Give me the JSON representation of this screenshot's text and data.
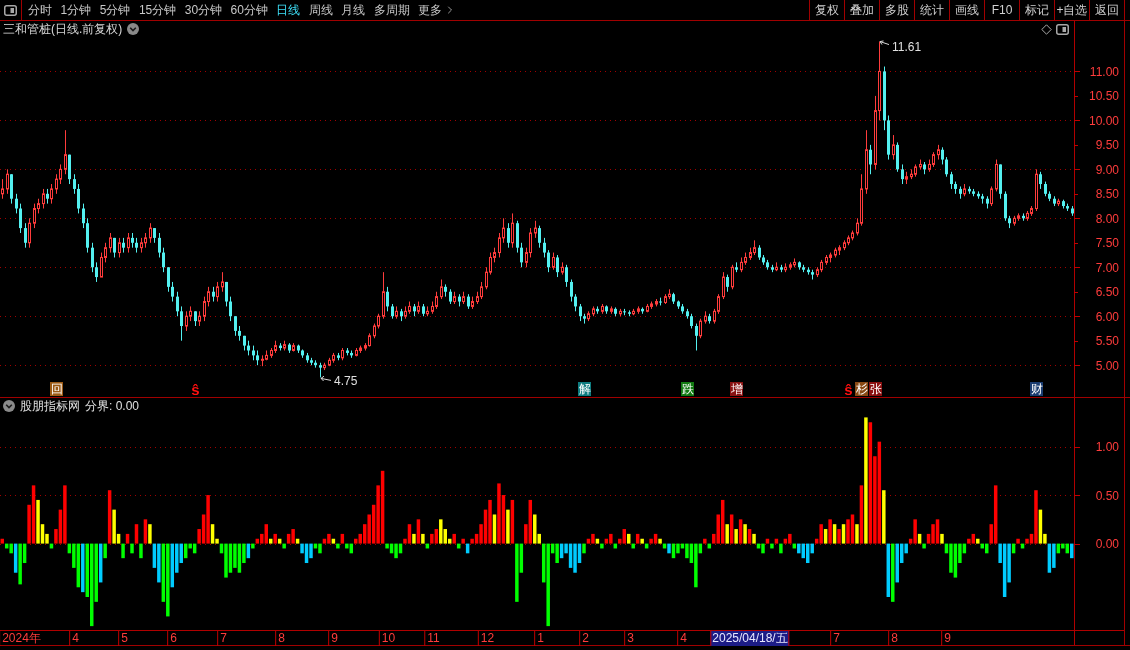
{
  "toolbar": {
    "tabs": [
      {
        "label": "分时",
        "selected": false
      },
      {
        "label": "1分钟",
        "selected": false
      },
      {
        "label": "5分钟",
        "selected": false
      },
      {
        "label": "15分钟",
        "selected": false
      },
      {
        "label": "30分钟",
        "selected": false
      },
      {
        "label": "60分钟",
        "selected": false
      },
      {
        "label": "日线",
        "selected": true
      },
      {
        "label": "周线",
        "selected": false
      },
      {
        "label": "月线",
        "selected": false
      },
      {
        "label": "多周期",
        "selected": false
      }
    ],
    "more_label": "更多",
    "buttons": [
      "复权",
      "叠加",
      "多股",
      "统计",
      "画线",
      "F10",
      "标记",
      "+自选",
      "返回"
    ]
  },
  "price": {
    "title": "三和管桩(日线.前复权)",
    "chart_data": {
      "type": "candlestick",
      "grid": true,
      "ylim": [
        4.35,
        12.03
      ],
      "yticks": [
        {
          "value": 5,
          "label": "5.00"
        },
        {
          "value": 5.5,
          "label": "5.50"
        },
        {
          "value": 6,
          "label": "6.00"
        },
        {
          "value": 6.5,
          "label": "6.50"
        },
        {
          "value": 7,
          "label": "7.00"
        },
        {
          "value": 7.5,
          "label": "7.50"
        },
        {
          "value": 8,
          "label": "8.00"
        },
        {
          "value": 8.5,
          "label": "8.50"
        },
        {
          "value": 9,
          "label": "9.00"
        },
        {
          "value": 9.5,
          "label": "9.50"
        },
        {
          "value": 10,
          "label": "10.00"
        },
        {
          "value": 10.5,
          "label": "10.50"
        },
        {
          "value": 11,
          "label": "11.00"
        }
      ],
      "annotations": [
        "11.61",
        "4.75"
      ],
      "categories": [
        null,
        null,
        null,
        null,
        null,
        null,
        null,
        null,
        null,
        null,
        null,
        null,
        "回",
        null,
        null,
        null,
        null,
        null,
        null,
        null,
        null,
        null,
        null,
        null,
        null,
        null,
        null,
        null,
        null,
        null,
        null,
        null,
        null,
        null,
        null,
        null,
        null,
        null,
        null,
        null,
        null,
        null,
        null,
        "ŝ",
        null,
        null,
        null,
        null,
        null,
        null,
        null,
        null,
        null,
        null,
        null,
        null,
        null,
        null,
        null,
        null,
        null,
        null,
        null,
        null,
        null,
        null,
        null,
        null,
        null,
        null,
        null,
        null,
        null,
        null,
        null,
        null,
        null,
        null,
        null,
        null,
        null,
        null,
        null,
        null,
        null,
        null,
        null,
        null,
        null,
        null,
        null,
        null,
        null,
        null,
        null,
        null,
        null,
        null,
        null,
        null,
        null,
        null,
        null,
        null,
        null,
        null,
        null,
        null,
        null,
        null,
        null,
        null,
        null,
        null,
        null,
        null,
        null,
        null,
        null,
        null,
        null,
        null,
        null,
        null,
        null,
        null,
        null,
        null,
        null,
        null,
        "解",
        null,
        null,
        null,
        null,
        null,
        null,
        null,
        null,
        null,
        null,
        null,
        null,
        null,
        null,
        null,
        null,
        null,
        null,
        null,
        null,
        null,
        null,
        "跌",
        null,
        null,
        null,
        null,
        null,
        null,
        null,
        null,
        null,
        null,
        "增",
        null,
        null,
        null,
        null,
        null,
        null,
        null,
        null,
        null,
        null,
        null,
        null,
        null,
        null,
        null,
        null,
        null,
        null,
        null,
        null,
        null,
        null,
        null,
        null,
        "ŝ",
        null,
        null,
        "杉",
        null,
        null,
        "张",
        null,
        null,
        null,
        null,
        null,
        null,
        null,
        null,
        null,
        null,
        null,
        null,
        null,
        null,
        null,
        null,
        null,
        null,
        null,
        null,
        null,
        null,
        null,
        null,
        null,
        null,
        null,
        null,
        null,
        null,
        null,
        null,
        null,
        null,
        null,
        "财",
        null,
        null,
        null,
        null,
        null,
        null,
        null,
        null
      ],
      "ohlc": [
        [
          8.5,
          8.8,
          8.4,
          8.6
        ],
        [
          8.6,
          9.0,
          8.5,
          8.9
        ],
        [
          8.9,
          8.9,
          8.3,
          8.4
        ],
        [
          8.4,
          8.5,
          8.1,
          8.2
        ],
        [
          8.2,
          8.3,
          7.7,
          7.8
        ],
        [
          7.8,
          7.9,
          7.4,
          7.5
        ],
        [
          7.5,
          8.0,
          7.4,
          7.9
        ],
        [
          7.9,
          8.3,
          7.8,
          8.2
        ],
        [
          8.2,
          8.4,
          8.1,
          8.3
        ],
        [
          8.3,
          8.6,
          8.2,
          8.5
        ],
        [
          8.5,
          8.6,
          8.3,
          8.4
        ],
        [
          8.4,
          8.7,
          8.3,
          8.6
        ],
        [
          8.6,
          8.9,
          8.5,
          8.8
        ],
        [
          8.8,
          9.1,
          8.7,
          9.0
        ],
        [
          9.0,
          9.8,
          8.9,
          9.3
        ],
        [
          9.3,
          9.3,
          8.7,
          8.8
        ],
        [
          8.8,
          8.9,
          8.5,
          8.6
        ],
        [
          8.6,
          8.7,
          8.1,
          8.2
        ],
        [
          8.2,
          8.3,
          7.8,
          7.9
        ],
        [
          7.9,
          8.0,
          7.3,
          7.4
        ],
        [
          7.4,
          7.5,
          6.9,
          7.0
        ],
        [
          7.0,
          7.1,
          6.7,
          6.8
        ],
        [
          6.8,
          7.3,
          6.8,
          7.2
        ],
        [
          7.2,
          7.5,
          7.1,
          7.4
        ],
        [
          7.4,
          7.7,
          7.3,
          7.6
        ],
        [
          7.6,
          7.6,
          7.2,
          7.3
        ],
        [
          7.3,
          7.6,
          7.2,
          7.5
        ],
        [
          7.5,
          7.6,
          7.3,
          7.4
        ],
        [
          7.4,
          7.7,
          7.3,
          7.6
        ],
        [
          7.6,
          7.7,
          7.4,
          7.5
        ],
        [
          7.5,
          7.6,
          7.3,
          7.4
        ],
        [
          7.4,
          7.6,
          7.3,
          7.5
        ],
        [
          7.5,
          7.7,
          7.4,
          7.6
        ],
        [
          7.6,
          7.9,
          7.5,
          7.8
        ],
        [
          7.8,
          7.8,
          7.5,
          7.6
        ],
        [
          7.6,
          7.7,
          7.2,
          7.3
        ],
        [
          7.3,
          7.4,
          6.9,
          7.0
        ],
        [
          7.0,
          7.0,
          6.5,
          6.6
        ],
        [
          6.6,
          6.7,
          6.3,
          6.4
        ],
        [
          6.4,
          6.5,
          6.0,
          6.1
        ],
        [
          6.1,
          6.2,
          5.5,
          5.8
        ],
        [
          5.8,
          6.1,
          5.7,
          6.0
        ],
        [
          6.0,
          6.2,
          5.9,
          6.1
        ],
        [
          6.1,
          6.1,
          5.8,
          5.9
        ],
        [
          5.9,
          6.1,
          5.8,
          6.0
        ],
        [
          6.0,
          6.4,
          5.9,
          6.3
        ],
        [
          6.3,
          6.6,
          6.2,
          6.5
        ],
        [
          6.5,
          6.6,
          6.3,
          6.4
        ],
        [
          6.4,
          6.7,
          6.3,
          6.6
        ],
        [
          6.6,
          6.9,
          6.5,
          6.7
        ],
        [
          6.7,
          6.7,
          6.2,
          6.3
        ],
        [
          6.3,
          6.4,
          5.9,
          6.0
        ],
        [
          6.0,
          6.0,
          5.6,
          5.7
        ],
        [
          5.7,
          5.8,
          5.5,
          5.6
        ],
        [
          5.6,
          5.6,
          5.3,
          5.4
        ],
        [
          5.4,
          5.5,
          5.2,
          5.3
        ],
        [
          5.3,
          5.4,
          5.1,
          5.2
        ],
        [
          5.2,
          5.3,
          5.0,
          5.1
        ],
        [
          5.1,
          5.2,
          4.98,
          5.12
        ],
        [
          5.12,
          5.3,
          5.1,
          5.2
        ],
        [
          5.2,
          5.35,
          5.15,
          5.3
        ],
        [
          5.3,
          5.5,
          5.25,
          5.4
        ],
        [
          5.4,
          5.45,
          5.3,
          5.35
        ],
        [
          5.35,
          5.5,
          5.3,
          5.42
        ],
        [
          5.42,
          5.45,
          5.25,
          5.3
        ],
        [
          5.3,
          5.45,
          5.28,
          5.4
        ],
        [
          5.4,
          5.42,
          5.25,
          5.3
        ],
        [
          5.3,
          5.32,
          5.15,
          5.2
        ],
        [
          5.2,
          5.25,
          5.05,
          5.1
        ],
        [
          5.1,
          5.15,
          5.0,
          5.05
        ],
        [
          5.05,
          5.1,
          4.95,
          5.0
        ],
        [
          5.0,
          5.05,
          4.75,
          4.95
        ],
        [
          4.95,
          5.05,
          4.9,
          5.0
        ],
        [
          5.0,
          5.15,
          4.98,
          5.1
        ],
        [
          5.1,
          5.25,
          5.05,
          5.2
        ],
        [
          5.2,
          5.25,
          5.1,
          5.15
        ],
        [
          5.15,
          5.35,
          5.1,
          5.3
        ],
        [
          5.3,
          5.35,
          5.2,
          5.25
        ],
        [
          5.25,
          5.3,
          5.15,
          5.2
        ],
        [
          5.2,
          5.35,
          5.18,
          5.3
        ],
        [
          5.3,
          5.4,
          5.25,
          5.35
        ],
        [
          5.35,
          5.45,
          5.3,
          5.4
        ],
        [
          5.4,
          5.65,
          5.38,
          5.6
        ],
        [
          5.6,
          5.85,
          5.55,
          5.8
        ],
        [
          5.8,
          6.05,
          5.75,
          6.0
        ],
        [
          6.0,
          6.9,
          5.95,
          6.5
        ],
        [
          6.5,
          6.6,
          6.1,
          6.2
        ],
        [
          6.2,
          6.25,
          5.95,
          6.0
        ],
        [
          6.0,
          6.2,
          5.95,
          6.1
        ],
        [
          6.1,
          6.15,
          5.9,
          6.0
        ],
        [
          6.0,
          6.2,
          5.95,
          6.1
        ],
        [
          6.1,
          6.3,
          6.05,
          6.2
        ],
        [
          6.2,
          6.25,
          6.0,
          6.1
        ],
        [
          6.1,
          6.3,
          6.05,
          6.2
        ],
        [
          6.2,
          6.25,
          6.0,
          6.05
        ],
        [
          6.05,
          6.2,
          6.0,
          6.1
        ],
        [
          6.1,
          6.3,
          6.05,
          6.2
        ],
        [
          6.2,
          6.5,
          6.15,
          6.4
        ],
        [
          6.4,
          6.75,
          6.35,
          6.6
        ],
        [
          6.6,
          6.65,
          6.4,
          6.5
        ],
        [
          6.5,
          6.55,
          6.25,
          6.3
        ],
        [
          6.3,
          6.5,
          6.25,
          6.4
        ],
        [
          6.4,
          6.45,
          6.2,
          6.3
        ],
        [
          6.3,
          6.5,
          6.25,
          6.4
        ],
        [
          6.4,
          6.45,
          6.15,
          6.2
        ],
        [
          6.2,
          6.4,
          6.15,
          6.3
        ],
        [
          6.3,
          6.5,
          6.25,
          6.4
        ],
        [
          6.4,
          6.7,
          6.35,
          6.6
        ],
        [
          6.6,
          7.0,
          6.55,
          6.9
        ],
        [
          6.9,
          7.3,
          6.85,
          7.2
        ],
        [
          7.2,
          7.4,
          7.1,
          7.3
        ],
        [
          7.3,
          7.7,
          7.2,
          7.6
        ],
        [
          7.6,
          8.0,
          7.5,
          7.8
        ],
        [
          7.8,
          7.9,
          7.4,
          7.5
        ],
        [
          7.5,
          8.1,
          7.4,
          7.9
        ],
        [
          7.9,
          7.95,
          7.3,
          7.4
        ],
        [
          7.4,
          7.5,
          7.0,
          7.1
        ],
        [
          7.1,
          7.4,
          7.0,
          7.3
        ],
        [
          7.3,
          7.8,
          7.2,
          7.7
        ],
        [
          7.7,
          7.95,
          7.6,
          7.8
        ],
        [
          7.8,
          7.85,
          7.4,
          7.5
        ],
        [
          7.5,
          7.6,
          7.2,
          7.3
        ],
        [
          7.3,
          7.35,
          6.9,
          7.0
        ],
        [
          7.0,
          7.3,
          6.95,
          7.2
        ],
        [
          7.2,
          7.25,
          6.8,
          6.9
        ],
        [
          6.9,
          7.1,
          6.85,
          7.0
        ],
        [
          7.0,
          7.05,
          6.6,
          6.7
        ],
        [
          6.7,
          6.75,
          6.3,
          6.4
        ],
        [
          6.4,
          6.45,
          6.1,
          6.2
        ],
        [
          6.2,
          6.25,
          5.9,
          6.0
        ],
        [
          6.0,
          6.05,
          5.85,
          5.95
        ],
        [
          5.95,
          6.1,
          5.9,
          6.05
        ],
        [
          6.05,
          6.2,
          6.0,
          6.15
        ],
        [
          6.15,
          6.2,
          6.05,
          6.1
        ],
        [
          6.1,
          6.25,
          6.05,
          6.2
        ],
        [
          6.2,
          6.22,
          6.05,
          6.1
        ],
        [
          6.1,
          6.2,
          6.05,
          6.15
        ],
        [
          6.15,
          6.18,
          6.0,
          6.05
        ],
        [
          6.05,
          6.15,
          6.0,
          6.1
        ],
        [
          6.1,
          6.15,
          6.02,
          6.08
        ],
        [
          6.08,
          6.12,
          6.0,
          6.05
        ],
        [
          6.05,
          6.15,
          6.02,
          6.1
        ],
        [
          6.1,
          6.2,
          6.05,
          6.15
        ],
        [
          6.15,
          6.18,
          6.05,
          6.1
        ],
        [
          6.1,
          6.25,
          6.08,
          6.2
        ],
        [
          6.2,
          6.3,
          6.15,
          6.25
        ],
        [
          6.25,
          6.35,
          6.2,
          6.3
        ],
        [
          6.3,
          6.38,
          6.22,
          6.28
        ],
        [
          6.28,
          6.45,
          6.25,
          6.4
        ],
        [
          6.4,
          6.55,
          6.35,
          6.45
        ],
        [
          6.45,
          6.48,
          6.25,
          6.3
        ],
        [
          6.3,
          6.32,
          6.15,
          6.2
        ],
        [
          6.2,
          6.25,
          6.05,
          6.1
        ],
        [
          6.1,
          6.15,
          5.95,
          6.0
        ],
        [
          6.0,
          6.05,
          5.75,
          5.8
        ],
        [
          5.8,
          5.85,
          5.3,
          5.6
        ],
        [
          5.6,
          5.95,
          5.55,
          5.9
        ],
        [
          5.9,
          6.1,
          5.85,
          6.0
        ],
        [
          6.0,
          6.05,
          5.85,
          5.9
        ],
        [
          5.9,
          6.15,
          5.85,
          6.1
        ],
        [
          6.1,
          6.45,
          6.05,
          6.4
        ],
        [
          6.4,
          6.9,
          6.35,
          6.8
        ],
        [
          6.8,
          6.85,
          6.5,
          6.6
        ],
        [
          6.6,
          7.05,
          6.55,
          7.0
        ],
        [
          7.0,
          7.1,
          6.9,
          6.95
        ],
        [
          6.95,
          7.2,
          6.9,
          7.1
        ],
        [
          7.1,
          7.3,
          7.05,
          7.2
        ],
        [
          7.2,
          7.4,
          7.15,
          7.3
        ],
        [
          7.3,
          7.55,
          7.25,
          7.4
        ],
        [
          7.4,
          7.45,
          7.15,
          7.2
        ],
        [
          7.2,
          7.25,
          7.05,
          7.1
        ],
        [
          7.1,
          7.15,
          6.95,
          7.0
        ],
        [
          7.0,
          7.05,
          6.9,
          6.95
        ],
        [
          6.95,
          7.1,
          6.92,
          7.0
        ],
        [
          7.0,
          7.05,
          6.9,
          6.95
        ],
        [
          6.95,
          7.08,
          6.9,
          7.0
        ],
        [
          7.0,
          7.1,
          6.95,
          7.05
        ],
        [
          7.05,
          7.18,
          7.0,
          7.1
        ],
        [
          7.1,
          7.12,
          6.95,
          7.0
        ],
        [
          7.0,
          7.05,
          6.9,
          6.95
        ],
        [
          6.95,
          7.0,
          6.85,
          6.9
        ],
        [
          6.9,
          6.95,
          6.75,
          6.85
        ],
        [
          6.85,
          7.0,
          6.8,
          6.95
        ],
        [
          6.95,
          7.15,
          6.9,
          7.1
        ],
        [
          7.1,
          7.25,
          7.05,
          7.2
        ],
        [
          7.2,
          7.3,
          7.1,
          7.25
        ],
        [
          7.25,
          7.4,
          7.2,
          7.35
        ],
        [
          7.35,
          7.45,
          7.25,
          7.4
        ],
        [
          7.4,
          7.55,
          7.35,
          7.5
        ],
        [
          7.5,
          7.65,
          7.45,
          7.6
        ],
        [
          7.6,
          7.75,
          7.55,
          7.7
        ],
        [
          7.7,
          8.0,
          7.65,
          7.9
        ],
        [
          7.9,
          8.9,
          7.85,
          8.6
        ],
        [
          8.6,
          9.8,
          8.5,
          9.4
        ],
        [
          9.4,
          9.5,
          8.9,
          9.1
        ],
        [
          9.1,
          10.5,
          9.0,
          10.2
        ],
        [
          10.2,
          11.61,
          10.0,
          11.0
        ],
        [
          11.0,
          11.1,
          9.8,
          10.0
        ],
        [
          10.0,
          10.1,
          9.2,
          9.3
        ],
        [
          9.3,
          9.7,
          9.2,
          9.5
        ],
        [
          9.5,
          9.55,
          8.95,
          9.0
        ],
        [
          9.0,
          9.1,
          8.7,
          8.8
        ],
        [
          8.8,
          8.95,
          8.7,
          8.85
        ],
        [
          8.85,
          9.0,
          8.8,
          8.9
        ],
        [
          8.9,
          9.1,
          8.85,
          9.05
        ],
        [
          9.05,
          9.2,
          9.0,
          9.1
        ],
        [
          9.1,
          9.15,
          8.9,
          9.0
        ],
        [
          9.0,
          9.2,
          8.95,
          9.1
        ],
        [
          9.1,
          9.35,
          9.05,
          9.3
        ],
        [
          9.3,
          9.5,
          9.2,
          9.4
        ],
        [
          9.4,
          9.45,
          9.1,
          9.2
        ],
        [
          9.2,
          9.25,
          8.85,
          8.9
        ],
        [
          8.9,
          8.95,
          8.6,
          8.7
        ],
        [
          8.7,
          8.75,
          8.5,
          8.6
        ],
        [
          8.6,
          8.65,
          8.4,
          8.5
        ],
        [
          8.5,
          8.7,
          8.45,
          8.6
        ],
        [
          8.6,
          8.65,
          8.5,
          8.55
        ],
        [
          8.55,
          8.6,
          8.45,
          8.5
        ],
        [
          8.5,
          8.55,
          8.4,
          8.45
        ],
        [
          8.45,
          8.5,
          8.3,
          8.4
        ],
        [
          8.4,
          8.45,
          8.2,
          8.3
        ],
        [
          8.3,
          8.65,
          8.25,
          8.6
        ],
        [
          8.6,
          9.2,
          8.55,
          9.1
        ],
        [
          9.1,
          9.1,
          8.4,
          8.5
        ],
        [
          8.5,
          8.55,
          7.95,
          8.0
        ],
        [
          8.0,
          8.05,
          7.8,
          7.9
        ],
        [
          7.9,
          8.05,
          7.85,
          8.0
        ],
        [
          8.0,
          8.1,
          7.95,
          8.05
        ],
        [
          8.05,
          8.1,
          7.95,
          8.0
        ],
        [
          8.0,
          8.15,
          7.95,
          8.1
        ],
        [
          8.1,
          8.25,
          8.05,
          8.2
        ],
        [
          8.2,
          9.0,
          8.15,
          8.9
        ],
        [
          8.9,
          8.95,
          8.6,
          8.7
        ],
        [
          8.7,
          8.75,
          8.45,
          8.5
        ],
        [
          8.5,
          8.55,
          8.35,
          8.4
        ],
        [
          8.4,
          8.45,
          8.25,
          8.3
        ],
        [
          8.3,
          8.4,
          8.25,
          8.35
        ],
        [
          8.35,
          8.38,
          8.2,
          8.25
        ],
        [
          8.25,
          8.3,
          8.15,
          8.2
        ],
        [
          8.2,
          8.25,
          8.05,
          8.1
        ]
      ]
    },
    "event_styles": [
      {
        "kind": "badge",
        "color": "#9c5a14"
      },
      {
        "kind": "symbol",
        "color": "#ff1010"
      },
      {
        "kind": "badge",
        "color": "#0e7c80"
      },
      {
        "kind": "badge",
        "color": "#127a12"
      },
      {
        "kind": "badge",
        "color": "#8a1212"
      },
      {
        "kind": "symbol",
        "color": "#ff1010"
      },
      {
        "kind": "badge",
        "color": "#8a4a14"
      },
      {
        "kind": "badge",
        "color": "#8a1010"
      },
      {
        "kind": "badge",
        "color": "#1a3c70"
      }
    ]
  },
  "indicator": {
    "name": "股朋指标网",
    "parameter": "分界: 0.00",
    "chart_data": {
      "type": "bar",
      "grid": true,
      "ylim": [
        -0.89,
        1.5
      ],
      "yticks": [
        {
          "value": 0,
          "label": "0.00"
        },
        {
          "value": 0.5,
          "label": "0.50"
        },
        {
          "value": 1,
          "label": "1.00"
        }
      ],
      "categories": [
        null,
        null,
        null,
        null,
        "2024年",
        null,
        null,
        null,
        null,
        null,
        null,
        null,
        null,
        null,
        null,
        null,
        "4",
        null,
        null,
        null,
        null,
        null,
        null,
        null,
        null,
        null,
        null,
        "5",
        null,
        null,
        null,
        null,
        null,
        null,
        null,
        null,
        null,
        null,
        "6",
        null,
        null,
        null,
        null,
        null,
        null,
        null,
        null,
        null,
        null,
        "7",
        null,
        null,
        null,
        null,
        null,
        null,
        null,
        null,
        null,
        null,
        null,
        null,
        "8",
        null,
        null,
        null,
        null,
        null,
        null,
        null,
        null,
        null,
        null,
        null,
        "9",
        null,
        null,
        null,
        null,
        null,
        null,
        null,
        null,
        null,
        null,
        null,
        "10",
        null,
        null,
        null,
        null,
        null,
        null,
        null,
        null,
        null,
        "11",
        null,
        null,
        null,
        null,
        null,
        null,
        null,
        null,
        null,
        null,
        null,
        "12",
        null,
        null,
        null,
        null,
        null,
        null,
        null,
        null,
        null,
        null,
        null,
        "1",
        null,
        null,
        null,
        null,
        null,
        null,
        null,
        null,
        null,
        "2",
        null,
        null,
        null,
        null,
        null,
        null,
        null,
        null,
        null,
        "3",
        null,
        null,
        null,
        null,
        null,
        null,
        null,
        null,
        null,
        null,
        null,
        "4",
        null,
        null,
        null,
        null,
        null,
        null,
        null,
        null,
        null,
        null,
        null,
        null,
        null,
        null,
        "2025/04/18/五",
        null,
        null,
        null,
        null,
        null,
        null,
        null,
        null,
        null,
        null,
        null,
        null,
        null,
        null,
        null,
        null,
        null,
        null,
        "7",
        null,
        null,
        null,
        null,
        null,
        null,
        null,
        null,
        null,
        null,
        null,
        null,
        "8",
        null,
        null,
        null,
        null,
        null,
        null,
        null,
        null,
        null,
        null,
        null,
        "9",
        null,
        null,
        null,
        null,
        null,
        null,
        null,
        null,
        null,
        null,
        null,
        null,
        null,
        null,
        null,
        null,
        null,
        null,
        null,
        null,
        null,
        null,
        null,
        null,
        null,
        null,
        null,
        null
      ],
      "values": [
        0.05,
        -0.05,
        -0.1,
        -0.3,
        -0.42,
        -0.2,
        0.4,
        0.6,
        0.45,
        0.2,
        0.1,
        -0.05,
        0.15,
        0.35,
        0.6,
        -0.1,
        -0.25,
        -0.45,
        -0.5,
        -0.55,
        -0.85,
        -0.6,
        -0.4,
        -0.15,
        0.55,
        0.35,
        0.1,
        -0.15,
        0.1,
        -0.1,
        0.2,
        -0.15,
        0.25,
        0.2,
        -0.25,
        -0.4,
        -0.6,
        -0.75,
        -0.45,
        -0.3,
        -0.2,
        -0.15,
        -0.05,
        -0.1,
        0.15,
        0.3,
        0.5,
        0.2,
        0.05,
        -0.1,
        -0.35,
        -0.3,
        -0.25,
        -0.3,
        -0.2,
        -0.15,
        -0.05,
        0.05,
        0.1,
        0.2,
        0.05,
        0.1,
        0.05,
        -0.05,
        0.1,
        0.15,
        0.05,
        -0.1,
        -0.2,
        -0.15,
        -0.05,
        -0.1,
        0.05,
        0.1,
        0.05,
        -0.05,
        0.1,
        -0.05,
        -0.1,
        0.05,
        0.1,
        0.2,
        0.3,
        0.4,
        0.6,
        0.75,
        -0.05,
        -0.1,
        -0.15,
        -0.1,
        0.05,
        0.2,
        0.1,
        0.25,
        0.1,
        -0.05,
        0.1,
        0.15,
        0.25,
        0.15,
        0.05,
        0.1,
        -0.05,
        0.05,
        -0.1,
        0.05,
        0.1,
        0.2,
        0.35,
        0.45,
        0.3,
        0.62,
        0.5,
        0.35,
        0.45,
        -0.6,
        -0.3,
        0.2,
        0.45,
        0.3,
        0.1,
        -0.4,
        -0.85,
        -0.1,
        -0.2,
        -0.15,
        -0.1,
        -0.25,
        -0.3,
        -0.2,
        -0.1,
        0.05,
        0.1,
        0.05,
        -0.05,
        0.05,
        0.1,
        -0.05,
        0.05,
        0.15,
        0.1,
        -0.05,
        0.1,
        0.05,
        -0.05,
        0.05,
        0.1,
        0.05,
        -0.05,
        -0.1,
        -0.15,
        -0.1,
        -0.05,
        -0.15,
        -0.2,
        -0.45,
        -0.1,
        0.05,
        -0.05,
        0.1,
        0.3,
        0.45,
        0.2,
        0.3,
        0.15,
        0.25,
        0.2,
        0.15,
        0.1,
        -0.05,
        -0.1,
        0.05,
        -0.05,
        0.05,
        -0.1,
        0.05,
        0.1,
        -0.05,
        -0.1,
        -0.15,
        -0.2,
        -0.1,
        0.05,
        0.2,
        0.15,
        0.25,
        0.2,
        0.15,
        0.2,
        0.25,
        0.3,
        0.2,
        0.6,
        1.3,
        1.25,
        0.9,
        1.05,
        0.55,
        -0.55,
        -0.6,
        -0.4,
        -0.2,
        -0.1,
        0.05,
        0.25,
        0.1,
        -0.05,
        0.1,
        0.2,
        0.25,
        0.1,
        -0.1,
        -0.3,
        -0.35,
        -0.2,
        -0.1,
        0.05,
        0.1,
        0.05,
        -0.05,
        -0.1,
        0.2,
        0.6,
        -0.2,
        -0.55,
        -0.4,
        -0.1,
        0.05,
        -0.05,
        0.05,
        0.1,
        0.55,
        0.35,
        0.1,
        -0.3,
        -0.25,
        -0.1,
        -0.05,
        -0.1,
        -0.15
      ],
      "colors": [
        "#ff0000",
        "#00ff00",
        "#00ff00",
        "#00ccff",
        "#00ff00",
        "#00ff00",
        "#ff0000",
        "#ff0000",
        "#ffff00",
        "#ffff00",
        "#ffff00",
        "#00ff00",
        "#ff0000",
        "#ff0000",
        "#ff0000",
        "#00ff00",
        "#00ff00",
        "#00ff00",
        "#00ccff",
        "#00ff00",
        "#00ff00",
        "#00ff00",
        "#00ccff",
        "#00ff00",
        "#ff0000",
        "#ffff00",
        "#ffff00",
        "#00ff00",
        "#ff0000",
        "#00ff00",
        "#ff0000",
        "#00ff00",
        "#ff0000",
        "#ffff00",
        "#00ccff",
        "#00ccff",
        "#00ff00",
        "#00ff00",
        "#00ccff",
        "#00ccff",
        "#00ccff",
        "#00ff00",
        "#00ff00",
        "#00ff00",
        "#ff0000",
        "#ff0000",
        "#ff0000",
        "#ffff00",
        "#ffff00",
        "#00ff00",
        "#00ff00",
        "#00ff00",
        "#00ff00",
        "#00ff00",
        "#00ff00",
        "#00ccff",
        "#00ff00",
        "#ff0000",
        "#ff0000",
        "#ff0000",
        "#ffff00",
        "#ff0000",
        "#ffff00",
        "#00ff00",
        "#ff0000",
        "#ff0000",
        "#ffff00",
        "#00ccff",
        "#00ccff",
        "#00ccff",
        "#00ff00",
        "#00ff00",
        "#ff0000",
        "#ff0000",
        "#ffff00",
        "#00ff00",
        "#ff0000",
        "#00ff00",
        "#00ff00",
        "#ff0000",
        "#ff0000",
        "#ff0000",
        "#ff0000",
        "#ff0000",
        "#ff0000",
        "#ff0000",
        "#00ff00",
        "#00ff00",
        "#00ff00",
        "#00ff00",
        "#ff0000",
        "#ff0000",
        "#ffff00",
        "#ff0000",
        "#ffff00",
        "#00ff00",
        "#ff0000",
        "#ff0000",
        "#ffff00",
        "#ffff00",
        "#ffff00",
        "#ff0000",
        "#00ff00",
        "#ff0000",
        "#00ccff",
        "#ff0000",
        "#ff0000",
        "#ff0000",
        "#ff0000",
        "#ff0000",
        "#ffff00",
        "#ff0000",
        "#ff0000",
        "#ffff00",
        "#ff0000",
        "#00ff00",
        "#00ff00",
        "#ff0000",
        "#ff0000",
        "#ffff00",
        "#ffff00",
        "#00ff00",
        "#00ff00",
        "#00ff00",
        "#00ff00",
        "#00ccff",
        "#00ccff",
        "#00ccff",
        "#00ccff",
        "#00ccff",
        "#00ff00",
        "#ff0000",
        "#ff0000",
        "#ffff00",
        "#00ff00",
        "#ff0000",
        "#ff0000",
        "#00ff00",
        "#ff0000",
        "#ff0000",
        "#ffff00",
        "#00ff00",
        "#ff0000",
        "#ffff00",
        "#00ff00",
        "#ff0000",
        "#ff0000",
        "#ffff00",
        "#00ff00",
        "#00ccff",
        "#00ff00",
        "#00ff00",
        "#00ff00",
        "#00ff00",
        "#00ff00",
        "#00ff00",
        "#00ff00",
        "#ff0000",
        "#00ff00",
        "#ff0000",
        "#ff0000",
        "#ff0000",
        "#ffff00",
        "#ff0000",
        "#ffff00",
        "#ff0000",
        "#ffff00",
        "#ff0000",
        "#ffff00",
        "#00ff00",
        "#00ff00",
        "#ff0000",
        "#00ff00",
        "#ff0000",
        "#00ff00",
        "#ff0000",
        "#ff0000",
        "#00ff00",
        "#00ccff",
        "#00ccff",
        "#00ccff",
        "#00ccff",
        "#ff0000",
        "#ff0000",
        "#ffff00",
        "#ff0000",
        "#ffff00",
        "#ff0000",
        "#ffff00",
        "#ff0000",
        "#ff0000",
        "#ffff00",
        "#ff0000",
        "#ffff00",
        "#ff0000",
        "#ff0000",
        "#ff0000",
        "#ffff00",
        "#00ccff",
        "#00ff00",
        "#00ccff",
        "#00ccff",
        "#00ccff",
        "#ff0000",
        "#ff0000",
        "#ffff00",
        "#00ff00",
        "#ff0000",
        "#ff0000",
        "#ff0000",
        "#ffff00",
        "#00ff00",
        "#00ff00",
        "#00ff00",
        "#00ff00",
        "#00ff00",
        "#ff0000",
        "#ff0000",
        "#ffff00",
        "#00ff00",
        "#00ff00",
        "#ff0000",
        "#ff0000",
        "#00ccff",
        "#00ccff",
        "#00ccff",
        "#00ff00",
        "#ff0000",
        "#00ff00",
        "#ff0000",
        "#ff0000",
        "#ff0000",
        "#ffff00",
        "#ffff00",
        "#00ccff",
        "#00ccff",
        "#00ff00",
        "#00ff00",
        "#00ff00",
        "#00ccff"
      ]
    },
    "date_label_states": [
      {
        "selected": false
      },
      {
        "selected": false
      },
      {
        "selected": false
      },
      {
        "selected": false
      },
      {
        "selected": false
      },
      {
        "selected": false
      },
      {
        "selected": false
      },
      {
        "selected": false
      },
      {
        "selected": false
      },
      {
        "selected": false
      },
      {
        "selected": false
      },
      {
        "selected": false
      },
      {
        "selected": false
      },
      {
        "selected": false
      },
      {
        "selected": true
      },
      {
        "selected": false
      },
      {
        "selected": false
      },
      {
        "selected": false
      }
    ]
  }
}
